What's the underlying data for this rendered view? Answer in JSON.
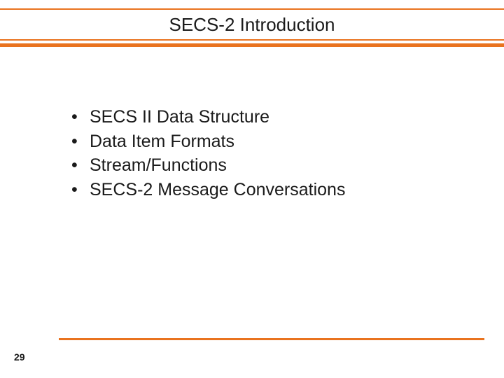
{
  "accent_color": "#e9731f",
  "slide": {
    "title": "SECS-2 Introduction",
    "bullets": [
      "SECS II Data Structure",
      "Data Item Formats",
      "Stream/Functions",
      "SECS-2 Message Conversations"
    ],
    "page_number": "29"
  }
}
